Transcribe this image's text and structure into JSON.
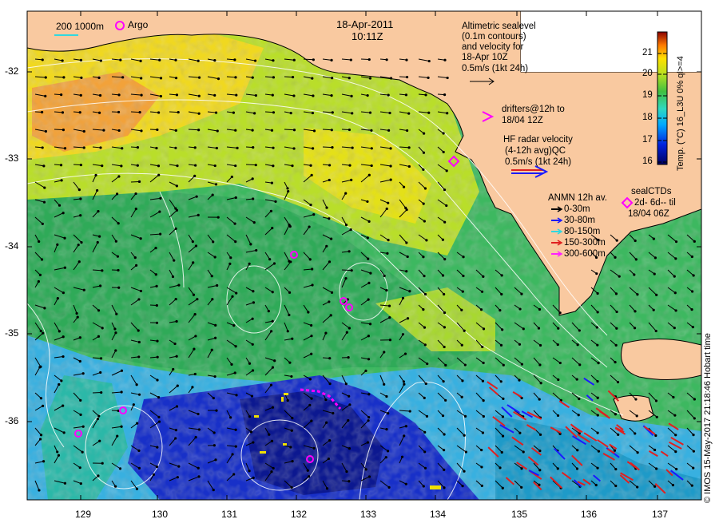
{
  "header": {
    "date": "18-Apr-2011",
    "time": "10:11Z"
  },
  "scale": {
    "label": "200  1000m"
  },
  "argo": {
    "label": "Argo"
  },
  "altimetry": {
    "line1": "Altimetric sealevel",
    "line2": "(0.1m contours)",
    "line3": "and velocity for",
    "line4": "18-Apr 10Z",
    "line5": "0.5m/s (1kt 24h)"
  },
  "drifters": {
    "line1": "drifters@12h to",
    "line2": "18/04 12Z"
  },
  "hf_radar": {
    "line1": "HF radar velocity",
    "line2": "(4-12h avg)QC",
    "line3": "0.5m/s (1kt 24h)"
  },
  "anmn": {
    "title": "ANMN 12h av.",
    "items": [
      {
        "label": "0-30m",
        "color": "#000000"
      },
      {
        "label": "30-80m",
        "color": "#1a1aff"
      },
      {
        "label": "80-150m",
        "color": "#30d8e0"
      },
      {
        "label": "150-300m",
        "color": "#e02020"
      },
      {
        "label": "300-600m",
        "color": "#ff20ff"
      }
    ]
  },
  "seal": {
    "line1": "sealCTDs",
    "line2": "2d- 6d-- til",
    "line3": "18/04 06Z"
  },
  "colorbar": {
    "label": "Temp. (°C) 16_L3U 0% ql>=4",
    "ticks": [
      "21",
      "20",
      "19",
      "18",
      "17",
      "16"
    ]
  },
  "axes": {
    "y_labels": [
      "-32",
      "-33",
      "-34",
      "-35",
      "-36"
    ],
    "x_labels": [
      "129",
      "130",
      "131",
      "132",
      "133",
      "134",
      "135",
      "136",
      "137"
    ]
  },
  "credit": "© IMOS 15-May-2017 21:18:46 Hobart time",
  "colors": {
    "land": "#f9c9a0",
    "drifter": "#ff00ff",
    "hf_arrow_red": "#e02020",
    "hf_arrow_blue": "#1a1aff",
    "contour": "#ffffff"
  },
  "icons": [
    "argo-circle-icon",
    "seal-diamond-icon",
    "drifter-chevron-icon",
    "velocity-arrow-icon"
  ]
}
